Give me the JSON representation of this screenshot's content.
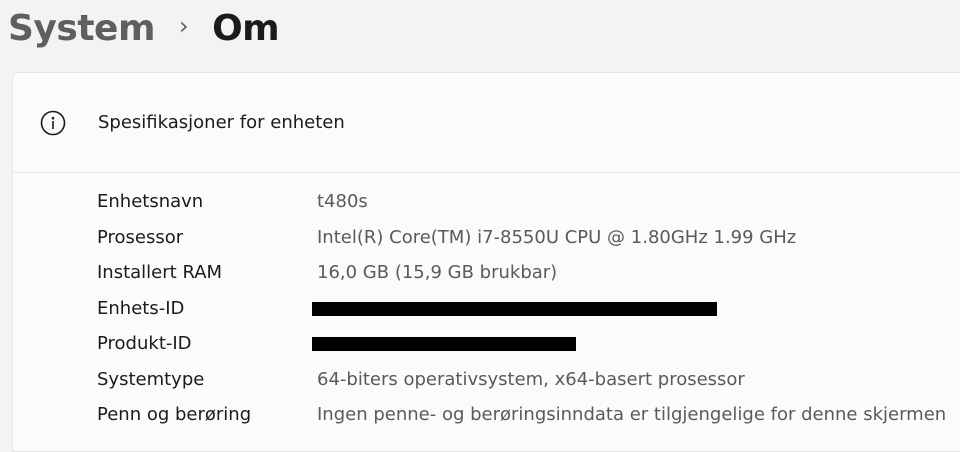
{
  "breadcrumb": {
    "parent": "System",
    "separator": "›",
    "current": "Om"
  },
  "card": {
    "title": "Spesifikasjoner for enheten",
    "icon": "info-icon"
  },
  "specs": [
    {
      "label": "Enhetsnavn",
      "value": "t480s",
      "redacted": false
    },
    {
      "label": "Prosessor",
      "value": "Intel(R) Core(TM) i7-8550U CPU @ 1.80GHz   1.99 GHz",
      "redacted": false
    },
    {
      "label": "Installert RAM",
      "value": "16,0 GB (15,9 GB brukbar)",
      "redacted": false
    },
    {
      "label": "Enhets-ID",
      "value": "",
      "redacted": true
    },
    {
      "label": "Produkt-ID",
      "value": "",
      "redacted": true
    },
    {
      "label": "Systemtype",
      "value": "64-biters operativsystem, x64-basert prosessor",
      "redacted": false
    },
    {
      "label": "Penn og berøring",
      "value": "Ingen penne- og berøringsinndata er tilgjengelige for denne skjermen",
      "redacted": false
    }
  ]
}
